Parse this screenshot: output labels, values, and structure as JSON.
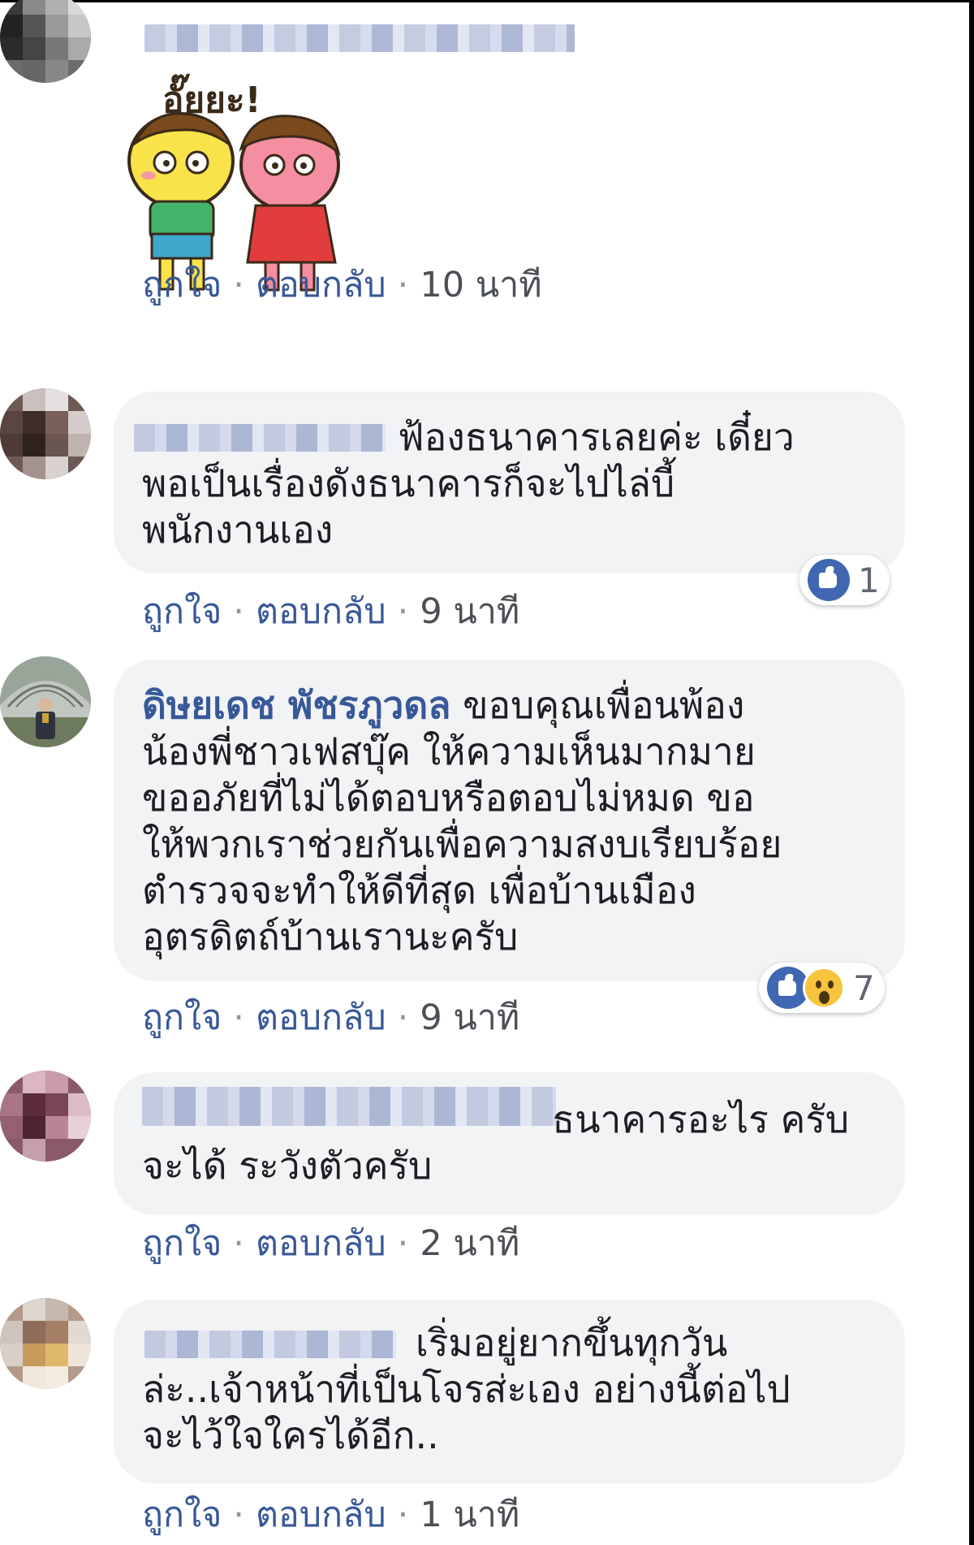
{
  "comments": [
    {
      "text": "",
      "sticker": {
        "caption": "อั๊ยยะ!"
      },
      "actions": {
        "like": "ถูกใจ",
        "reply": "ตอบกลับ",
        "time": "10 นาที"
      }
    },
    {
      "lines": [
        "ฟ้องธนาคารเลยค่ะ เดี๋ยว",
        "พอเป็นเรื่องดังธนาคารก็จะไปไล่บี้",
        "พนักงานเอง"
      ],
      "reactions": {
        "count": "1",
        "icons": [
          "like-icon"
        ]
      },
      "actions": {
        "like": "ถูกใจ",
        "reply": "ตอบกลับ",
        "time": "9 นาที"
      }
    },
    {
      "author": "ดิษยเดช พัชรภูวดล",
      "lines": [
        "ขอบคุณเพื่อนพ้อง",
        "น้องพี่ชาวเฟสบุ๊ค ให้ความเห็นมากมาย",
        "ขออภัยที่ไม่ได้ตอบหรือตอบไม่หมด ขอ",
        "ให้พวกเราช่วยกันเพื่อความสงบเรียบร้อย",
        "ตำรวจจะทำให้ดีที่สุด เพื่อบ้านเมือง",
        "อุตรดิตถ์บ้านเรานะครับ"
      ],
      "reactions": {
        "count": "7",
        "icons": [
          "like-icon",
          "wow-icon"
        ]
      },
      "actions": {
        "like": "ถูกใจ",
        "reply": "ตอบกลับ",
        "time": "9 นาที"
      }
    },
    {
      "lines": [
        "ธนาคารอะไร ครับ",
        "จะได้ ระวังตัวครับ"
      ],
      "actions": {
        "like": "ถูกใจ",
        "reply": "ตอบกลับ",
        "time": "2 นาที"
      }
    },
    {
      "lines": [
        "เริ่มอยู่ยากขึ้นทุกวัน",
        "ล่ะ..เจ้าหน้าที่เป็นโจรส่ะเอง อย่างนี้ต่อไป",
        "จะไว้ใจใครได้อีก.."
      ],
      "actions": {
        "like": "ถูกใจ",
        "reply": "ตอบกลับ",
        "time": "1 นาที"
      }
    }
  ],
  "colors": {
    "link": "#385898",
    "bubble": "#f2f3f5",
    "meta": "#606770",
    "like": "#4267b2"
  }
}
